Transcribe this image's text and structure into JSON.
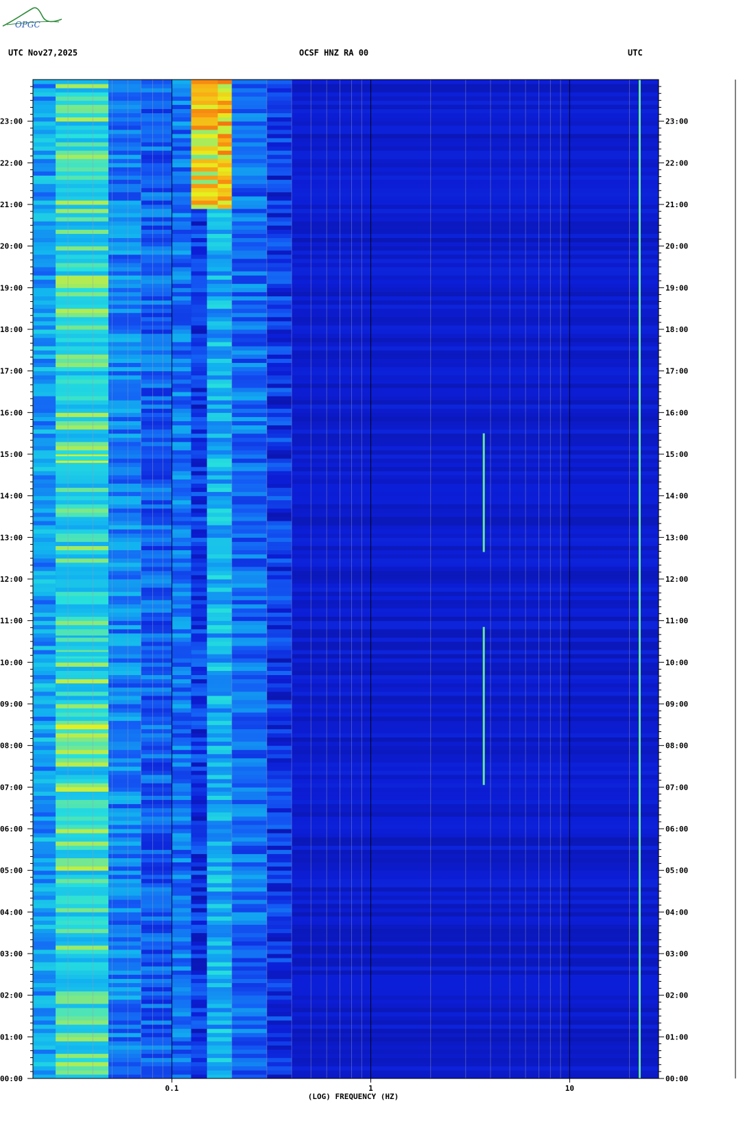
{
  "logo": {
    "name": "opgc-logo",
    "text": "OPGC"
  },
  "header": {
    "left": "UTC  Nov27,2025",
    "center": "OCSF HNZ RA 00",
    "right": "UTC"
  },
  "colors": {
    "low": "#0a10c8",
    "mid": "#12b4f0",
    "high": "#f0f020",
    "peak": "#f04010"
  },
  "chart_data": {
    "type": "heatmap",
    "title": "OCSF HNZ RA 00",
    "xlabel": "(LOG) FREQUENCY (HZ)",
    "ylabel": "UTC",
    "x_scale": "log",
    "xlim": [
      0.02,
      28
    ],
    "x_tick_labels": [
      "0.1",
      "1",
      "10"
    ],
    "x_ticks": [
      0.1,
      1,
      10
    ],
    "ylim": [
      "00:00",
      "24:00"
    ],
    "y_tick_labels": [
      "00:00",
      "01:00",
      "02:00",
      "03:00",
      "04:00",
      "05:00",
      "06:00",
      "07:00",
      "08:00",
      "09:00",
      "10:00",
      "11:00",
      "12:00",
      "13:00",
      "14:00",
      "15:00",
      "16:00",
      "17:00",
      "18:00",
      "19:00",
      "20:00",
      "21:00",
      "22:00",
      "23:00"
    ],
    "frequency_bands": [
      {
        "f_low": 0.02,
        "f_high": 0.026,
        "level": 0.45
      },
      {
        "f_low": 0.026,
        "f_high": 0.048,
        "level": 0.62
      },
      {
        "f_low": 0.048,
        "f_high": 0.07,
        "level": 0.38
      },
      {
        "f_low": 0.07,
        "f_high": 0.1,
        "level": 0.3
      },
      {
        "f_low": 0.1,
        "f_high": 0.125,
        "level": 0.35
      },
      {
        "f_low": 0.125,
        "f_high": 0.15,
        "level": 0.2
      },
      {
        "f_low": 0.15,
        "f_high": 0.2,
        "level": 0.5
      },
      {
        "f_low": 0.2,
        "f_high": 0.3,
        "level": 0.33
      },
      {
        "f_low": 0.3,
        "f_high": 0.4,
        "level": 0.2
      },
      {
        "f_low": 0.4,
        "f_high": 28,
        "level": 0.1
      }
    ],
    "strong_events": [
      {
        "f_low": 0.125,
        "f_high": 0.17,
        "t_start": 20.9,
        "t_end": 24.0,
        "level": 0.95
      },
      {
        "f_low": 0.026,
        "f_high": 0.048,
        "t_start": 10.65,
        "t_end": 10.75,
        "level": 0.85
      },
      {
        "f_low": 0.026,
        "f_high": 0.048,
        "t_start": 10.15,
        "t_end": 10.25,
        "level": 0.8
      },
      {
        "f_low": 0.026,
        "f_high": 0.048,
        "t_start": 8.4,
        "t_end": 8.5,
        "level": 0.85
      },
      {
        "f_low": 0.026,
        "f_high": 0.048,
        "t_start": 14.85,
        "t_end": 14.95,
        "level": 0.8
      },
      {
        "f_low": 0.026,
        "f_high": 0.048,
        "t_start": 6.9,
        "t_end": 7.0,
        "level": 0.8
      },
      {
        "f_low": 0.026,
        "f_high": 0.048,
        "t_start": 4.5,
        "t_end": 4.6,
        "level": 0.75
      }
    ],
    "narrowband_lines": [
      {
        "freq": 3.7,
        "t_start": 12.65,
        "t_end": 15.5
      },
      {
        "freq": 3.7,
        "t_start": 7.05,
        "t_end": 10.85
      },
      {
        "freq": 22.5,
        "t_start": 0.0,
        "t_end": 24.0
      }
    ],
    "grid": true
  }
}
